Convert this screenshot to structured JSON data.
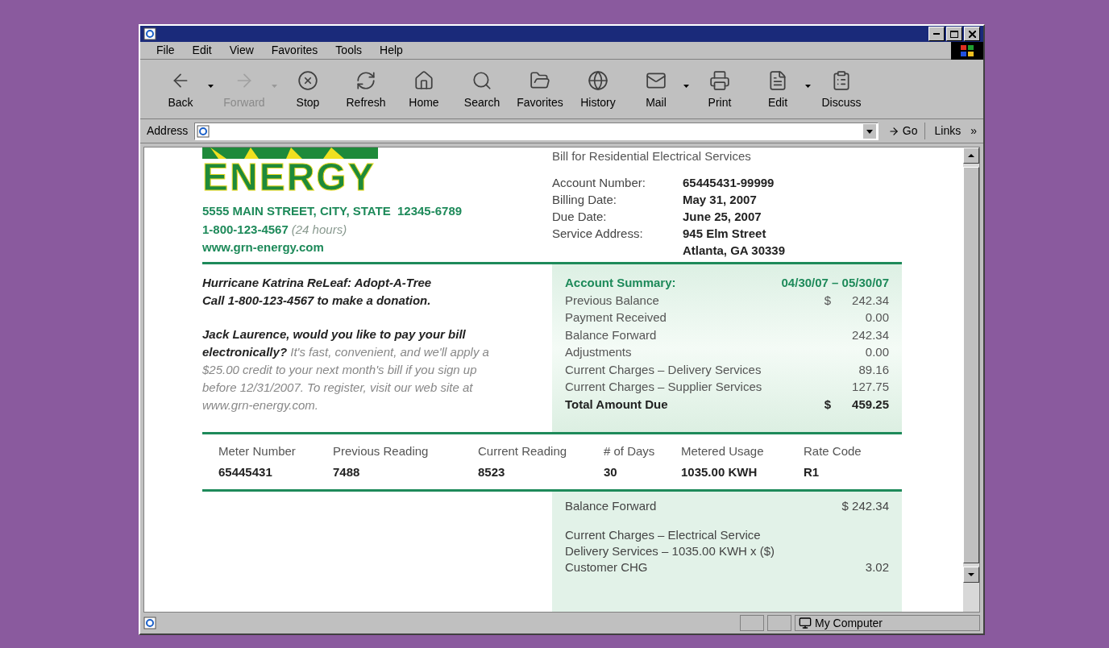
{
  "menu": [
    "File",
    "Edit",
    "View",
    "Favorites",
    "Tools",
    "Help"
  ],
  "toolbar": [
    {
      "kind": "back",
      "label": "Back",
      "disabled": false,
      "dropdown": true
    },
    {
      "kind": "forward",
      "label": "Forward",
      "disabled": true,
      "dropdown": true
    },
    {
      "kind": "stop",
      "label": "Stop",
      "disabled": false,
      "dropdown": false
    },
    {
      "kind": "refresh",
      "label": "Refresh",
      "disabled": false,
      "dropdown": false
    },
    {
      "kind": "home",
      "label": "Home",
      "disabled": false,
      "dropdown": false
    },
    {
      "kind": "search",
      "label": "Search",
      "disabled": false,
      "dropdown": false
    },
    {
      "kind": "favorites",
      "label": "Favorites",
      "disabled": false,
      "dropdown": false
    },
    {
      "kind": "history",
      "label": "History",
      "disabled": false,
      "dropdown": false
    },
    {
      "kind": "mail",
      "label": "Mail",
      "disabled": false,
      "dropdown": true
    },
    {
      "kind": "print",
      "label": "Print",
      "disabled": false,
      "dropdown": false
    },
    {
      "kind": "edit",
      "label": "Edit",
      "disabled": false,
      "dropdown": true
    },
    {
      "kind": "discuss",
      "label": "Discuss",
      "disabled": false,
      "dropdown": false
    }
  ],
  "address_bar": {
    "label": "Address",
    "go": "Go",
    "links": "Links",
    "links_chevron": "»"
  },
  "bill": {
    "heading": "Bill for Residential Electrical Services",
    "logo_text": "ENERGY",
    "company": {
      "address": "5555 MAIN STREET, CITY, STATE  12345-6789",
      "phone": "1-800-123-4567",
      "phone_note": "(24 hours)",
      "website": "www.grn-energy.com"
    },
    "account_info": [
      {
        "label": "Account Number:",
        "values": [
          "65445431-99999"
        ]
      },
      {
        "label": "Billing Date:",
        "values": [
          "May 31, 2007"
        ]
      },
      {
        "label": "Due Date:",
        "values": [
          "June 25, 2007"
        ]
      },
      {
        "label": "Service Address:",
        "values": [
          "945 Elm Street",
          "Atlanta, GA  30339"
        ]
      }
    ],
    "promo_lines": [
      "Hurricane Katrina ReLeaf: Adopt-A-Tree",
      "Call 1-800-123-4567 to make a donation."
    ],
    "promo_offer": "**Jack Laurence, would you like to pay your bill electronically?** It's fast, convenient, and we'll apply a $25.00 credit to your next month's bill if you sign up before 12/31/2007. To register, visit our web site at www.grn-energy.com.",
    "summary": {
      "title": "Account Summary:",
      "period": "04/30/07 – 05/30/07",
      "rows": [
        {
          "kind": "normal",
          "label": "Previous Balance",
          "currency": "$",
          "amount": "242.34"
        },
        {
          "kind": "normal",
          "label": "Payment Received",
          "amount": "0.00"
        },
        {
          "kind": "normal",
          "label": "Balance Forward",
          "amount": "242.34"
        },
        {
          "kind": "normal",
          "label": "Adjustments",
          "amount": "0.00"
        },
        {
          "kind": "normal",
          "label": "Current Charges – Delivery Services",
          "amount": "89.16"
        },
        {
          "kind": "normal",
          "label": "Current Charges – Supplier Services",
          "amount": "127.75"
        },
        {
          "kind": "total",
          "label": "Total Amount Due",
          "currency": "$",
          "amount": "459.25"
        }
      ]
    },
    "meter": {
      "columns": [
        "Meter Number",
        "Previous Reading",
        "Current Reading",
        "# of Days",
        "Metered Usage",
        "Rate Code"
      ],
      "row": [
        "65445431",
        "7488",
        "8523",
        "30",
        "1035.00 KWH",
        "R1"
      ]
    },
    "charges": [
      {
        "kind": "line",
        "label": "Balance Forward",
        "amount": "$ 242.34"
      },
      {
        "kind": "group",
        "label": "Current Charges – Electrical Service"
      },
      {
        "kind": "line",
        "label": "Delivery Services – 1035.00 KWH x ($)"
      },
      {
        "kind": "line",
        "label": "Customer CHG",
        "amount": "3.02"
      }
    ]
  },
  "status_bar": {
    "zone": "My Computer"
  }
}
